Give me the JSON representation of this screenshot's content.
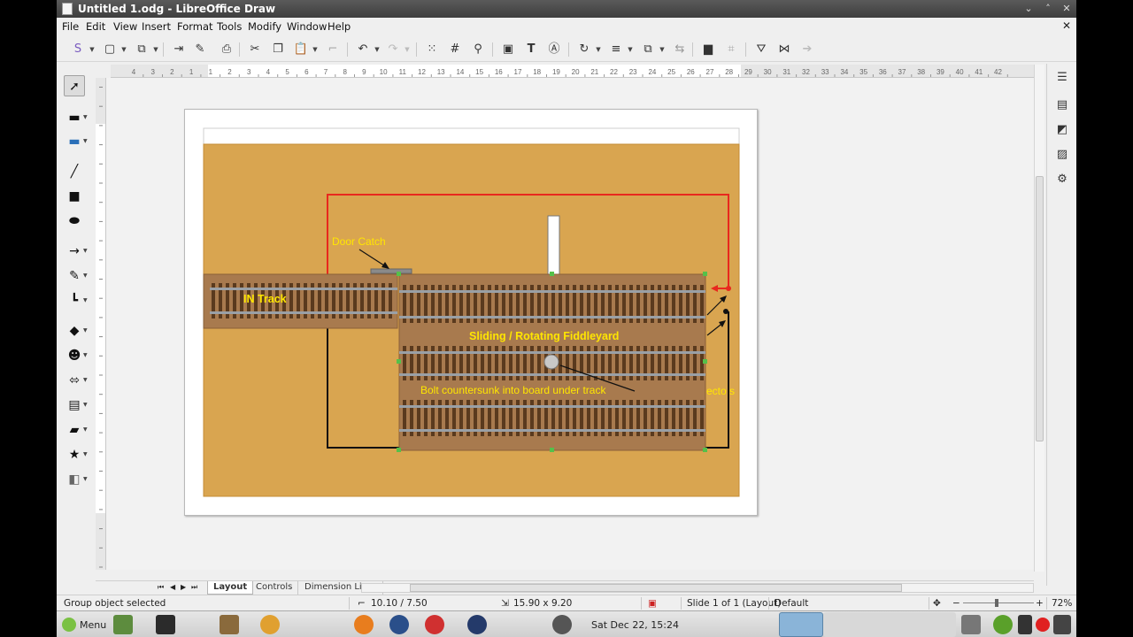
{
  "window": {
    "title": "Untitled 1.odg - LibreOffice Draw",
    "controls": [
      "⌄",
      "˄",
      "✕"
    ]
  },
  "menu": [
    "File",
    "Edit",
    "View",
    "Insert",
    "Format",
    "Tools",
    "Modify",
    "Window",
    "Help"
  ],
  "ruler": {
    "h_labels": [
      "4",
      "3",
      "2",
      "1",
      "1",
      "2",
      "3",
      "4",
      "5",
      "6",
      "7",
      "8",
      "9",
      "10",
      "11",
      "12",
      "13",
      "14",
      "15",
      "16",
      "17",
      "18",
      "19",
      "20",
      "21",
      "22",
      "23",
      "24",
      "25",
      "26",
      "27",
      "28",
      "29",
      "30",
      "31",
      "32",
      "33",
      "34",
      "35",
      "36",
      "37",
      "38",
      "39",
      "40",
      "41",
      "42"
    ]
  },
  "drawing": {
    "labels": {
      "door_catch": "Door Catch",
      "in_track": "IN Track",
      "fiddleyard": "Sliding / Rotating Fiddleyard",
      "bolt": "Bolt countersunk into board under track",
      "connectors": "ecto s"
    },
    "colors": {
      "background": "#d9a550",
      "board": "#a87a4e",
      "tie": "#5a3a1e",
      "rail": "#9aa0a6",
      "label": "#ffe600",
      "red_line": "#e8281e"
    }
  },
  "tabs": {
    "items": [
      "Layout",
      "Controls",
      "Dimension Lines"
    ],
    "active": "Layout"
  },
  "status": {
    "selection": "Group object selected",
    "position": "10.10 / 7.50",
    "size": "15.90 x 9.20",
    "slide": "Slide 1 of 1 (Layout)",
    "master": "Default",
    "zoom": "72%"
  },
  "taskbar": {
    "menu_label": "Menu",
    "clock": "Sat Dec 22, 15:24"
  }
}
